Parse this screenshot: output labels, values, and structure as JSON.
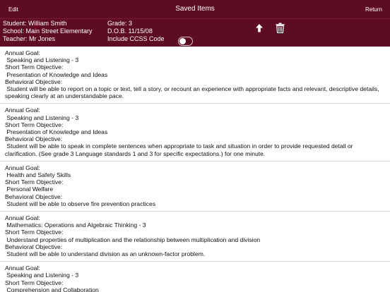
{
  "navbar": {
    "edit_label": "Edit",
    "title": "Saved Items",
    "return_label": "Return",
    "background": "#5e0b24"
  },
  "student": {
    "name_line": "Student: William Smith",
    "school_line": "School: Main Street Elementary",
    "teacher_line": "Teacher: Mr Jones",
    "grade_line": "Grade: 3",
    "dob_line": "D.O.B.  11/15/08",
    "ccss_label": "Include CCSS Code",
    "ccss_enabled": false
  },
  "icons": {
    "upload": "upload-arrow-icon",
    "trash": "trash-icon"
  },
  "items": [
    {
      "lines": [
        "Annual Goal:",
        " Speaking and Listening - 3",
        "Short Term Objective:",
        " Presentation of Knowledge and Ideas",
        "Behavioral Objective:",
        " Student will be able to report on a topic or text, tell a story, or recount an experience with appropriate facts and relevant, descriptive details, speaking clearly at an understandable pace."
      ]
    },
    {
      "lines": [
        "Annual Goal:",
        " Speaking and Listening - 3",
        "Short Term Objective:",
        " Presentation of Knowledge and Ideas",
        "Behavioral Objective:",
        " Student will be able to speak in complete sentences when appropriate to task and situation in order to provide requested detail or clarification. (See grade 3 Language standards 1 and 3 for specific expectations.) for one minute."
      ]
    },
    {
      "lines": [
        "Annual Goal:",
        " Health and Safety Skills",
        "Short Term Objective:",
        " Personal Welfare",
        "Behavioral Objective:",
        " Student will be able to observe fire prevention practices"
      ]
    },
    {
      "lines": [
        "Annual Goal:",
        " Mathematics: Operations and Algebraic Thinking - 3",
        "Short Term Objective:",
        " Understand properties of multiplication and the relationship between multiplication and division",
        "Behavioral Objective:",
        " Student will be able to understand division as an unknown-factor problem."
      ]
    },
    {
      "lines": [
        "Annual Goal:",
        " Speaking and Listening - 3",
        "Short Term Objective:",
        " Comprehension and Collaboration"
      ]
    }
  ]
}
